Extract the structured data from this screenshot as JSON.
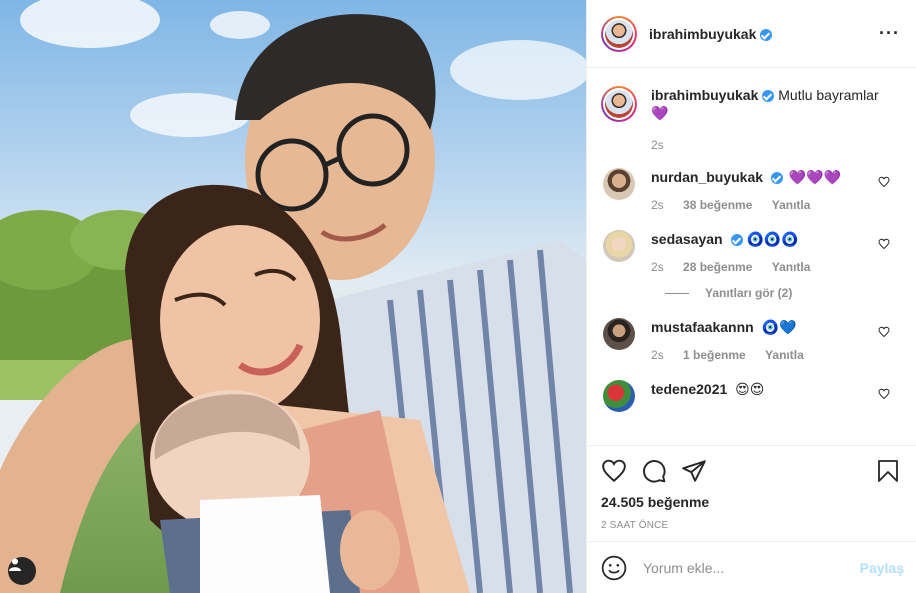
{
  "post": {
    "author": "ibrahimbuyukak",
    "caption_text": "Mutlu bayramlar",
    "caption_emoji": "💜",
    "caption_time": "2s"
  },
  "comments": [
    {
      "user": "nurdan_buyukak",
      "verified": true,
      "text": "💜💜💜",
      "time": "2s",
      "likes": "38 beğenme",
      "reply": "Yanıtla"
    },
    {
      "user": "sedasayan",
      "verified": true,
      "text": "🧿🧿🧿",
      "time": "2s",
      "likes": "28 beğenme",
      "reply": "Yanıtla",
      "view_replies": "Yanıtları gör (2)"
    },
    {
      "user": "mustafaakannn",
      "verified": false,
      "text": "🧿💙",
      "time": "2s",
      "likes": "1 beğenme",
      "reply": "Yanıtla"
    },
    {
      "user": "tedene2021",
      "verified": false,
      "text": "😍😍"
    }
  ],
  "stats": {
    "likes": "24.505 beğenme",
    "posted": "2 SAAT ÖNCE"
  },
  "add_comment": {
    "placeholder": "Yorum ekle...",
    "post_label": "Paylaş"
  },
  "icons": {
    "more": "more-options-icon",
    "like": "heart-icon",
    "comment": "comment-icon",
    "share": "share-icon",
    "save": "bookmark-icon",
    "emoji": "emoji-icon",
    "tag": "user-tag-icon"
  },
  "colors": {
    "verified": "#3897f0",
    "post_disabled": "#b2dffc",
    "muted": "#8e8e8e"
  }
}
